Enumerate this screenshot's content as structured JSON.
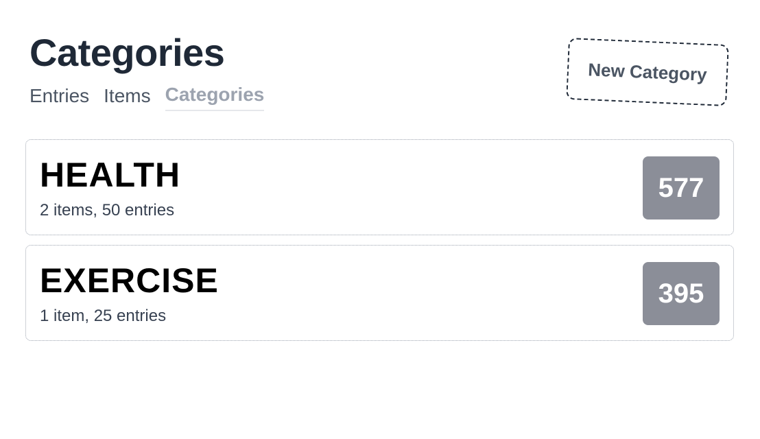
{
  "header": {
    "title": "Categories",
    "new_button_label": "New Category"
  },
  "nav": {
    "tabs": [
      {
        "label": "Entries",
        "active": false
      },
      {
        "label": "Items",
        "active": false
      },
      {
        "label": "Categories",
        "active": true
      }
    ]
  },
  "categories": [
    {
      "name": "HEALTH",
      "meta": "2 items, 50 entries",
      "score": "577"
    },
    {
      "name": "EXERCISE",
      "meta": "1 item, 25 entries",
      "score": "395"
    }
  ],
  "colors": {
    "title": "#1f2937",
    "tab_inactive": "#4b5563",
    "tab_active": "#9ca3af",
    "score_badge_bg": "#8b8e98",
    "score_badge_text": "#ffffff"
  }
}
